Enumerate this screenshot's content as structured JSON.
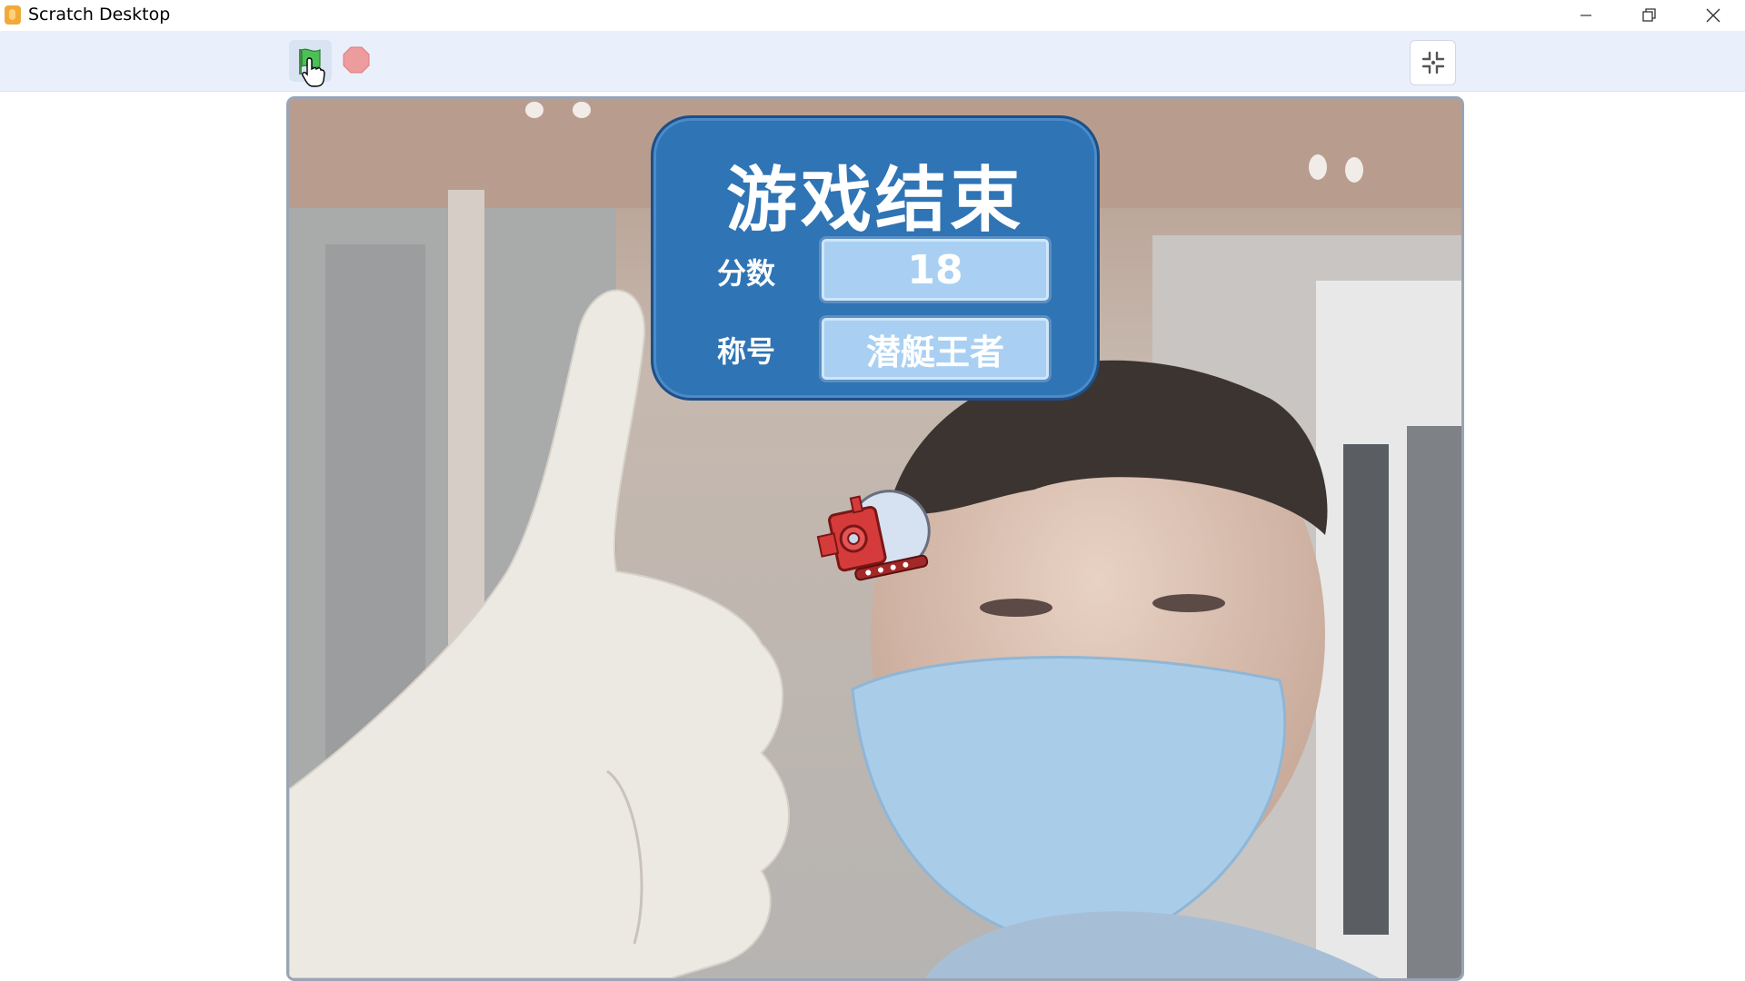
{
  "window": {
    "title": "Scratch Desktop",
    "icons": [
      "scratch-app-icon",
      "minimize-icon",
      "restore-icon",
      "close-icon"
    ]
  },
  "toolbar": {
    "green_flag": "green-flag-icon",
    "stop": "stop-icon",
    "fullscreen_exit": "exit-fullscreen-icon"
  },
  "game_over_panel": {
    "title": "游戏结束",
    "score_label": "分数",
    "score_value": "18",
    "rank_label": "称号",
    "rank_value": "潜艇王者"
  },
  "colors": {
    "panel_blue": "#2f74b4",
    "value_box": "#a9d0f2",
    "green_flag": "#4cbf56",
    "stop_red": "#ec9c9c",
    "toolbar_bg": "#e9f0fc"
  }
}
